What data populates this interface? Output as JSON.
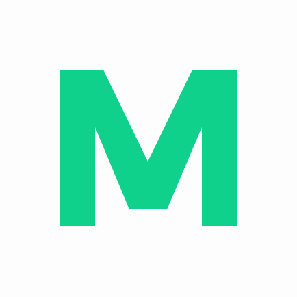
{
  "logo": {
    "letter": "M",
    "color": "#0fd18c",
    "background": "#fdfdfd",
    "icon": "m-letter-logo-icon"
  }
}
